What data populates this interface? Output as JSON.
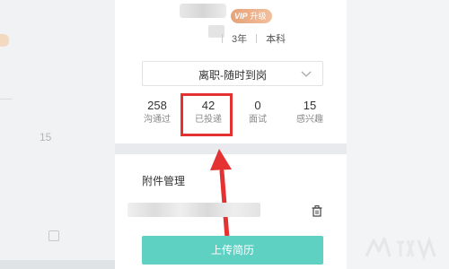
{
  "profile": {
    "vip_tag": "VIP",
    "vip_text": "升级",
    "experience": "3年",
    "education": "本科"
  },
  "status": {
    "value": "离职-随时到岗"
  },
  "stats": [
    {
      "value": "258",
      "label": "沟通过"
    },
    {
      "value": "42",
      "label": "已投递"
    },
    {
      "value": "0",
      "label": "面试"
    },
    {
      "value": "15",
      "label": "感兴趣"
    }
  ],
  "attachments": {
    "title": "附件管理",
    "upload_label": "上传简历"
  },
  "background": {
    "left_number": "15"
  },
  "colors": {
    "highlight": "#e43131",
    "upload_button": "#5fd1c3",
    "vip_badge": "#e7a277"
  },
  "icons": {
    "status_dropdown": "chevron-down-icon",
    "attachment_delete": "trash-icon"
  }
}
